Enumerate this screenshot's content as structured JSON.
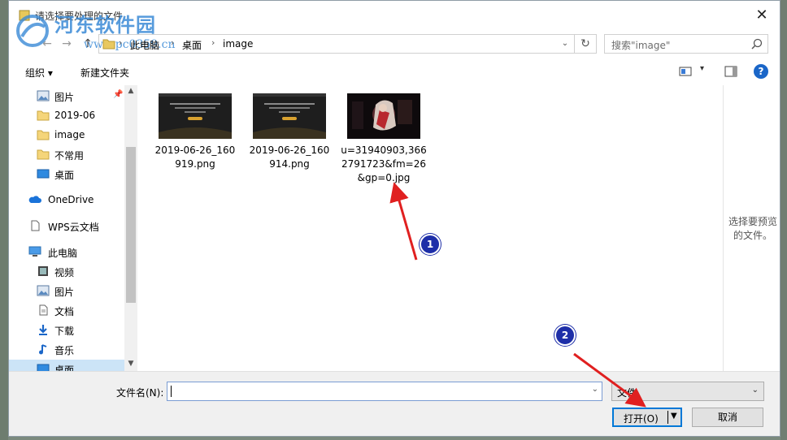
{
  "window": {
    "title": "请选择要处理的文件",
    "close_glyph": "✕"
  },
  "watermark": {
    "name": "河东软件园",
    "url": "www.pc0359.cn"
  },
  "nav": {
    "back_glyph": "←",
    "forward_glyph": "→",
    "up_glyph": "↑",
    "breadcrumb": [
      "此电脑",
      "桌面",
      "image"
    ],
    "separator": "›",
    "dropdown_glyph": "⌄",
    "refresh_glyph": "↻",
    "search_placeholder": "搜索\"image\""
  },
  "toolbar": {
    "organize": "组织 ▾",
    "new_folder": "新建文件夹",
    "help": "?",
    "view_dropdown": "▾"
  },
  "sidebar": {
    "items": [
      {
        "label": "图片",
        "icon": "picture-icon",
        "pinned": true
      },
      {
        "label": "2019-06",
        "icon": "folder-icon"
      },
      {
        "label": "image",
        "icon": "folder-icon"
      },
      {
        "label": "不常用",
        "icon": "folder-icon"
      },
      {
        "label": "桌面",
        "icon": "desktop-icon"
      },
      {
        "label": "OneDrive",
        "icon": "cloud-icon"
      },
      {
        "label": "WPS云文档",
        "icon": "document-icon"
      },
      {
        "label": "此电脑",
        "icon": "computer-icon"
      },
      {
        "label": "视频",
        "icon": "video-icon"
      },
      {
        "label": "图片",
        "icon": "picture-icon"
      },
      {
        "label": "文档",
        "icon": "document-icon"
      },
      {
        "label": "下载",
        "icon": "download-icon"
      },
      {
        "label": "音乐",
        "icon": "music-icon"
      },
      {
        "label": "桌面",
        "icon": "desktop-icon",
        "selected": true
      }
    ],
    "pin_glyph": "📌",
    "scroll_up": "▲",
    "scroll_down": "▼"
  },
  "files": [
    {
      "name": "2019-06-26_160919.png",
      "kind": "dark-screenshot"
    },
    {
      "name": "2019-06-26_160914.png",
      "kind": "dark-screenshot"
    },
    {
      "name": "u=31940903,3662791723&fm=26&gp=0.jpg",
      "kind": "photo"
    }
  ],
  "preview": {
    "text": "选择要预览的文件。"
  },
  "footer": {
    "filename_label": "文件名(N):",
    "filename_value": "",
    "dropdown_glyph": "⌄",
    "file_type": "文件",
    "open_label": "打开(O)",
    "open_dropdown": "▼",
    "cancel_label": "取消"
  },
  "annotations": [
    {
      "number": "1"
    },
    {
      "number": "2"
    }
  ],
  "colors": {
    "accent": "#0078d7",
    "selection": "#cce4f7",
    "arrow": "#e02020",
    "marker": "#1d2ea8"
  }
}
